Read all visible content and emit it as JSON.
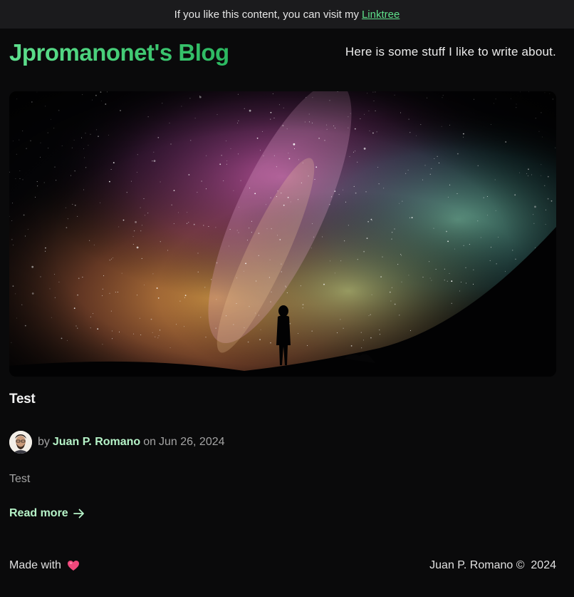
{
  "topbar": {
    "text": "If you like this content, you can visit my",
    "link_label": "Linktree"
  },
  "header": {
    "brand": "Jpromanonet's Blog",
    "tagline": "Here is some stuff I like to write about."
  },
  "post": {
    "hero_image": "starry-night-milky-way-silhouette",
    "title": "Test",
    "by_label": "by",
    "author": "Juan P. Romano",
    "on_label": "on",
    "date": "Jun 26, 2024",
    "excerpt": "Test",
    "read_more": "Read more",
    "read_more_icon": "arrow-right-icon"
  },
  "footer": {
    "made_with": "Made with",
    "heart_icon": "heart-icon",
    "copyright": "Juan P. Romano ©  2024"
  },
  "colors": {
    "background": "#0a0a0b",
    "topbar": "#1b1b1d",
    "accent": "#5ee08a",
    "accent_light": "#b6f3c8",
    "heart": "#f0487c"
  }
}
